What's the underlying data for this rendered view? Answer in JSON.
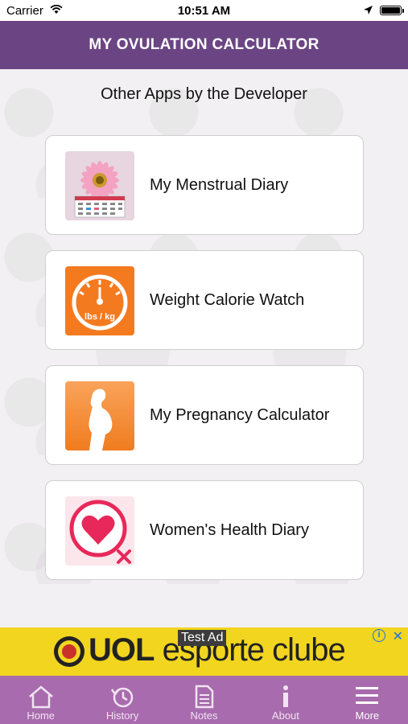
{
  "status_bar": {
    "carrier": "Carrier",
    "time": "10:51 AM"
  },
  "nav": {
    "title": "MY OVULATION CALCULATOR"
  },
  "section": {
    "title": "Other Apps by the Developer"
  },
  "apps": [
    {
      "name": "My Menstrual Diary",
      "icon": "flower-calendar-icon"
    },
    {
      "name": "Weight Calorie Watch",
      "icon": "scale-gauge-icon",
      "icon_text": "lbs / kg"
    },
    {
      "name": "My Pregnancy Calculator",
      "icon": "pregnant-silhouette-icon"
    },
    {
      "name": "Women's Health Diary",
      "icon": "heart-female-symbol-icon"
    }
  ],
  "ad": {
    "label": "Test Ad",
    "brand": "UOL",
    "text": "esporte clube",
    "info": "i",
    "close": "✕"
  },
  "tabs": [
    {
      "label": "Home",
      "icon": "home-icon"
    },
    {
      "label": "History",
      "icon": "history-icon"
    },
    {
      "label": "Notes",
      "icon": "notes-icon"
    },
    {
      "label": "About",
      "icon": "info-icon"
    },
    {
      "label": "More",
      "icon": "menu-icon",
      "active": true
    }
  ],
  "colors": {
    "nav": "#6b4583",
    "tab_bar": "#a86bad",
    "ad_bg": "#f2d51f",
    "weight_icon": "#f47a20",
    "pregnancy_icon": "#f47a20",
    "heart": "#e8285a"
  }
}
